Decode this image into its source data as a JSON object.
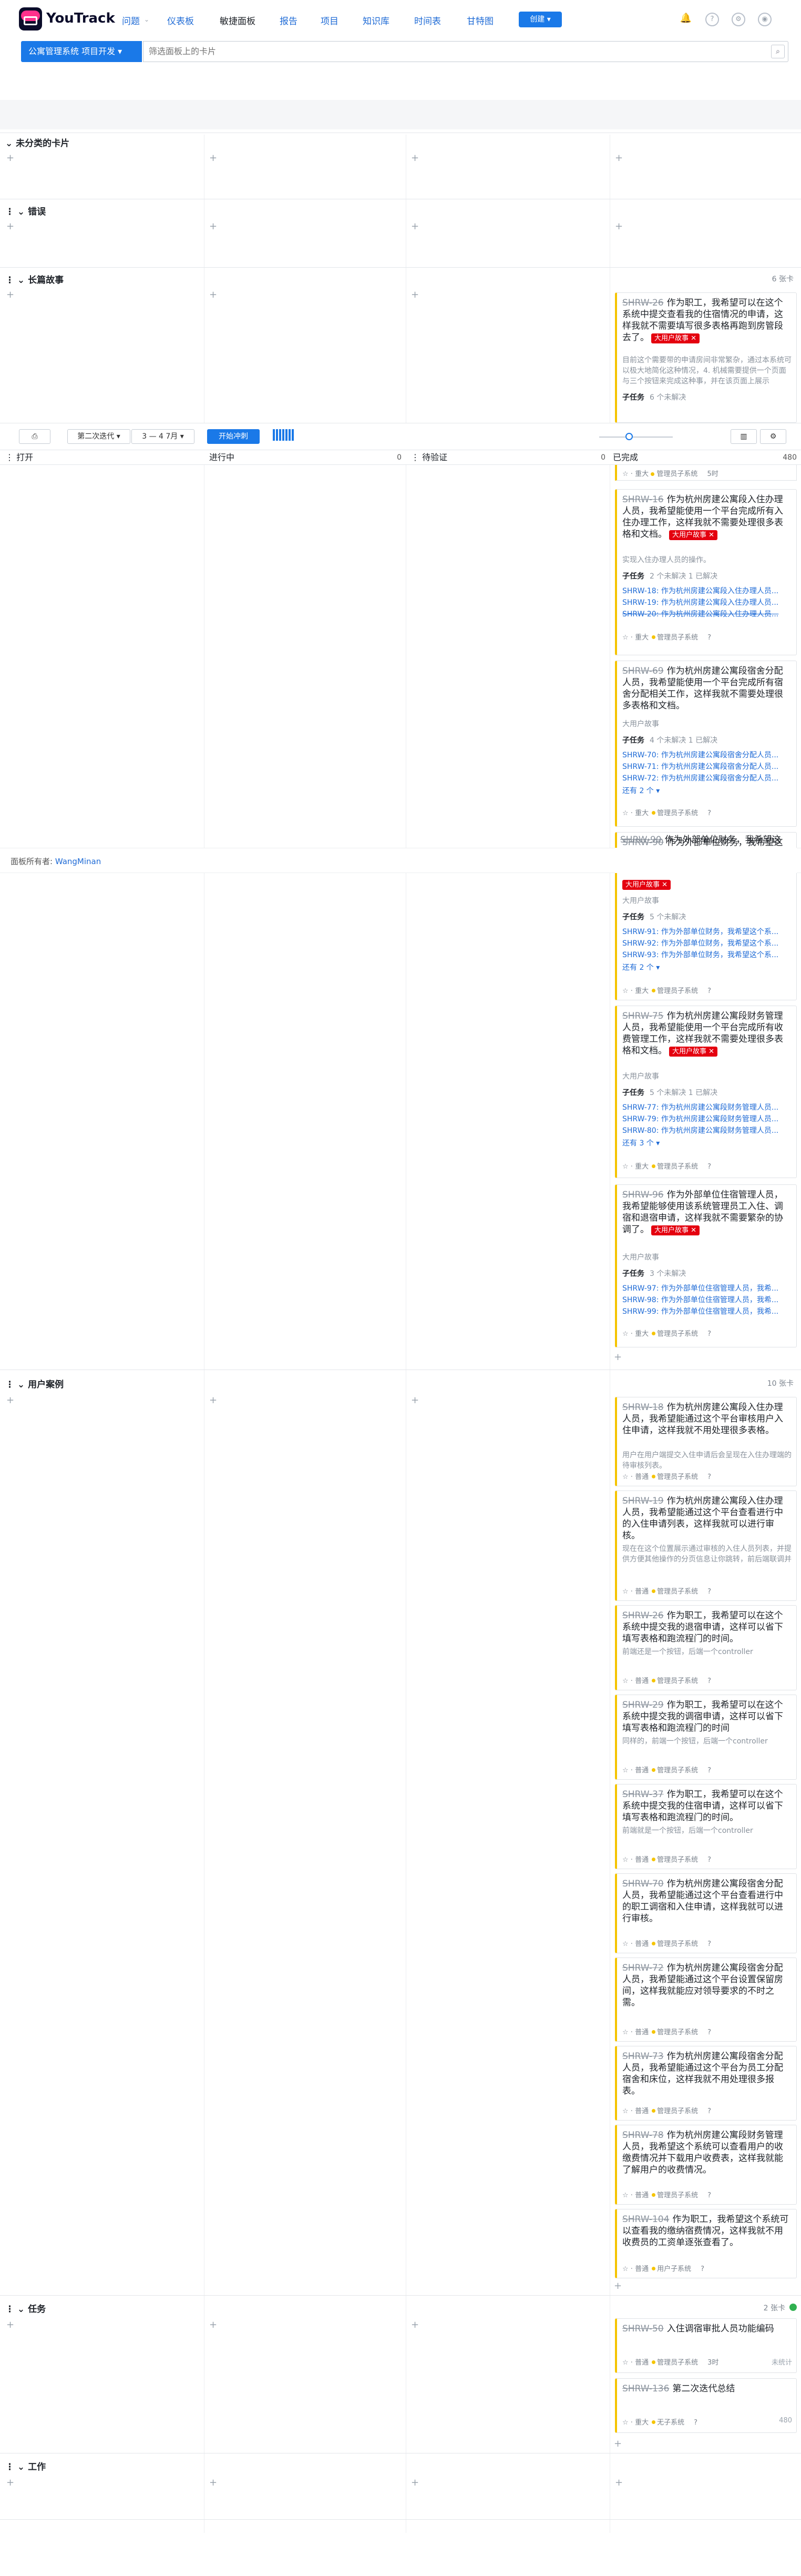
{
  "app": {
    "name": "YouTrack"
  },
  "nav": {
    "issues": "问题",
    "dashboards": "仪表板",
    "agile": "敏捷面板",
    "reports": "报告",
    "projects": "项目",
    "kb": "知识库",
    "timesheets": "时间表",
    "gantt": "甘特图",
    "create": "创建 ▾"
  },
  "header_icons": [
    "bell-icon",
    "help-icon",
    "settings-icon",
    "user-icon"
  ],
  "board": {
    "name": "公寓管理系统 项目开发",
    "search_placeholder": "筛选面板上的卡片"
  },
  "toolbar": {
    "sprint": "第二次迭代",
    "range": "3 — 4 7月",
    "start": "开始冲刺",
    "size_s": "S",
    "size_xl": "XL",
    "tv": "TV"
  },
  "columns": [
    {
      "name": "打开",
      "count": "0"
    },
    {
      "name": "进行中",
      "count": "0"
    },
    {
      "name": "待验证",
      "count": "0"
    },
    {
      "name": "已完成",
      "count": "480"
    }
  ],
  "swimlanes": {
    "uncategorized": "未分类的卡片",
    "bugs": "错误",
    "epics": "长篇故事",
    "epics_count": "6 张卡",
    "stories": "用户案例",
    "stories_count": "10 张卡",
    "tasks": "任务",
    "tasks_count": "2 张卡",
    "work": "工作"
  },
  "owner": {
    "label": "面板所有者:",
    "name": "WangMinan"
  },
  "epic_cards": [
    {
      "id": "SHRW-26",
      "title": "作为职工，我希望可以在这个系统中提交查看我的住宿情况的申请，这样我就不需要填写很多表格再跑到房管段去了。",
      "tag": "大用户故事 ✕",
      "desc": "目前这个需要带的申请房间非常繁杂，通过本系统可以极大地简化这种情况，4. 机械需要提供一个页面与三个按钮来完成这种事，并在该页面上展示",
      "subhdr": "子任务",
      "substat": "6 个未解决"
    },
    {
      "id": "SHRW-16",
      "title": "作为杭州房建公寓段入住办理人员，我希望能使用一个平台完成所有入住办理工作，这样我就不需要处理很多表格和文档。",
      "tag": "大用户故事 ✕",
      "desc": "实现入住办理人员的操作。",
      "subhdr": "子任务",
      "substat": "2 个未解决  1 已解决",
      "subs": [
        "SHRW-18: 作为杭州房建公寓段入住办理人员...",
        "SHRW-19: 作为杭州房建公寓段入住办理人员...",
        "SHRW-20: 作为杭州房建公寓段入住办理人员..."
      ],
      "meta": "重大",
      "sys": "管理员子系统",
      "est": "?"
    },
    {
      "id": "SHRW-69",
      "title": "作为杭州房建公寓段宿舍分配人员，我希望能使用一个平台完成所有宿舍分配相关工作，这样我就不需要处理很多表格和文档。",
      "tag": "",
      "desc": "大用户故事",
      "subhdr": "子任务",
      "substat": "4 个未解决  1 已解决",
      "subs": [
        "SHRW-70: 作为杭州房建公寓段宿舍分配人员...",
        "SHRW-71: 作为杭州房建公寓段宿舍分配人员...",
        "SHRW-72: 作为杭州房建公寓段宿舍分配人员..."
      ],
      "more": "还有 2 个 ▾",
      "meta": "重大",
      "sys": "管理员子系统",
      "est": "?"
    },
    {
      "id": "SHRW-90",
      "title": "作为外部单位财务，我希望这",
      "tag": "大用户故事 ✕",
      "desc": "大用户故事",
      "subhdr": "子任务",
      "substat": "5 个未解决",
      "subs": [
        "SHRW-91: 作为外部单位财务，我希望这个系...",
        "SHRW-92: 作为外部单位财务，我希望这个系...",
        "SHRW-93: 作为外部单位财务，我希望这个系..."
      ],
      "more": "还有 2 个 ▾",
      "meta": "重大",
      "sys": "管理员子系统",
      "est": "?"
    },
    {
      "id": "SHRW-75",
      "title": "作为杭州房建公寓段财务管理人员，我希望能使用一个平台完成所有收费管理工作，这样我就不需要处理很多表格和文档。",
      "tag": "大用户故事 ✕",
      "desc": "大用户故事",
      "subhdr": "子任务",
      "substat": "5 个未解决  1 已解决",
      "subs": [
        "SHRW-77: 作为杭州房建公寓段财务管理人员...",
        "SHRW-79: 作为杭州房建公寓段财务管理人员...",
        "SHRW-80: 作为杭州房建公寓段财务管理人员..."
      ],
      "more": "还有 3 个 ▾",
      "meta": "重大",
      "sys": "管理员子系统",
      "est": "?"
    },
    {
      "id": "SHRW-96",
      "title": "作为外部单位住宿管理人员，我希望能够使用该系统管理员工入住、调宿和退宿申请，这样我就不需要繁杂的协调了。",
      "tag": "大用户故事 ✕",
      "desc": "大用户故事",
      "subhdr": "子任务",
      "substat": "3 个未解决",
      "subs": [
        "SHRW-97: 作为外部单位住宿管理人员，我希...",
        "SHRW-98: 作为外部单位住宿管理人员，我希...",
        "SHRW-99: 作为外部单位住宿管理人员，我希..."
      ],
      "meta": "重大",
      "sys": "管理员子系统",
      "est": "?"
    }
  ],
  "epic_first_meta": {
    "meta": "重大",
    "sys": "管理员子系统",
    "est": "5时"
  },
  "story_cards": [
    {
      "id": "SHRW-18",
      "title": "作为杭州房建公寓段入住办理人员，我希望能通过这个平台审核用户入住申请，这样我就不用处理很多表格。",
      "desc": "用户在用户端提交入住申请后会呈现在入住办理端的待审核列表。",
      "meta": "普通",
      "sys": "管理员子系统",
      "est": "?"
    },
    {
      "id": "SHRW-19",
      "title": "作为杭州房建公寓段入住办理人员，我希望能通过这个平台查看进行中的入住申请列表，这样我就可以进行审核。",
      "desc": "现在在这个位置展示通过审核的入住人员列表，并提供方便其他操作的分页信息让你跳转，前后端联调并在一定的限制。将来会添加一个可能需要将",
      "meta": "普通",
      "sys": "管理员子系统",
      "est": "?"
    },
    {
      "id": "SHRW-26",
      "title": "作为职工，我希望可以在这个系统中提交我的退宿申请，这样可以省下填写表格和跑流程门的时间。",
      "desc": "前端还是一个按钮，后端一个controller",
      "meta": "普通",
      "sys": "管理员子系统",
      "est": "?"
    },
    {
      "id": "SHRW-29",
      "title": "作为职工，我希望可以在这个系统中提交我的调宿申请，这样可以省下填写表格和跑流程门的时间",
      "desc": "同样的，前端一个按钮，后端一个controller",
      "meta": "普通",
      "sys": "管理员子系统",
      "est": "?"
    },
    {
      "id": "SHRW-37",
      "title": "作为职工，我希望可以在这个系统中提交我的住宿申请，这样可以省下填写表格和跑流程门的时间。",
      "desc": "前端就是一个按钮，后端一个controller",
      "meta": "普通",
      "sys": "管理员子系统",
      "est": "?"
    },
    {
      "id": "SHRW-70",
      "title": "作为杭州房建公寓段宿舍分配人员，我希望能通过这个平台查看进行中的职工调宿和入住申请，这样我就可以进行审核。",
      "desc": "",
      "meta": "普通",
      "sys": "管理员子系统",
      "est": "?"
    },
    {
      "id": "SHRW-72",
      "title": "作为杭州房建公寓段宿舍分配人员，我希望能通过这个平台设置保留房间，这样我就能应对领导要求的不时之需。",
      "desc": "",
      "meta": "普通",
      "sys": "管理员子系统",
      "est": "?"
    },
    {
      "id": "SHRW-73",
      "title": "作为杭州房建公寓段宿舍分配人员，我希望能通过这个平台为员工分配宿舍和床位，这样我就不用处理很多报表。",
      "desc": "",
      "meta": "普通",
      "sys": "管理员子系统",
      "est": "?"
    },
    {
      "id": "SHRW-78",
      "title": "作为杭州房建公寓段财务管理人员，我希望这个系统可以查看用户的收缴费情况并下载用户收费表，这样我就能了解用户的收费情况。",
      "desc": "",
      "meta": "普通",
      "sys": "管理员子系统",
      "est": "?"
    },
    {
      "id": "SHRW-104",
      "title": "作为职工，我希望这个系统可以查看我的缴纳宿费情况，这样我就不用收费员的工资单逐张查看了。",
      "desc": "",
      "meta": "普通",
      "sys": "用户子系统",
      "est": "?"
    }
  ],
  "task_cards": [
    {
      "id": "SHRW-50",
      "title": "入住调宿审批人员功能编码",
      "meta": "普通",
      "sys": "管理员子系统",
      "est": "3时",
      "right": "未统计"
    },
    {
      "id": "SHRW-136",
      "title": "第二次迭代总结",
      "meta": "重大",
      "sys": "无子系统",
      "est": "?",
      "right": "480"
    }
  ],
  "colors": {
    "accent": "#1a79e8",
    "epic_tag": "#e4000f",
    "card_stripe": "#f5c400",
    "link": "#1f6bd6"
  }
}
